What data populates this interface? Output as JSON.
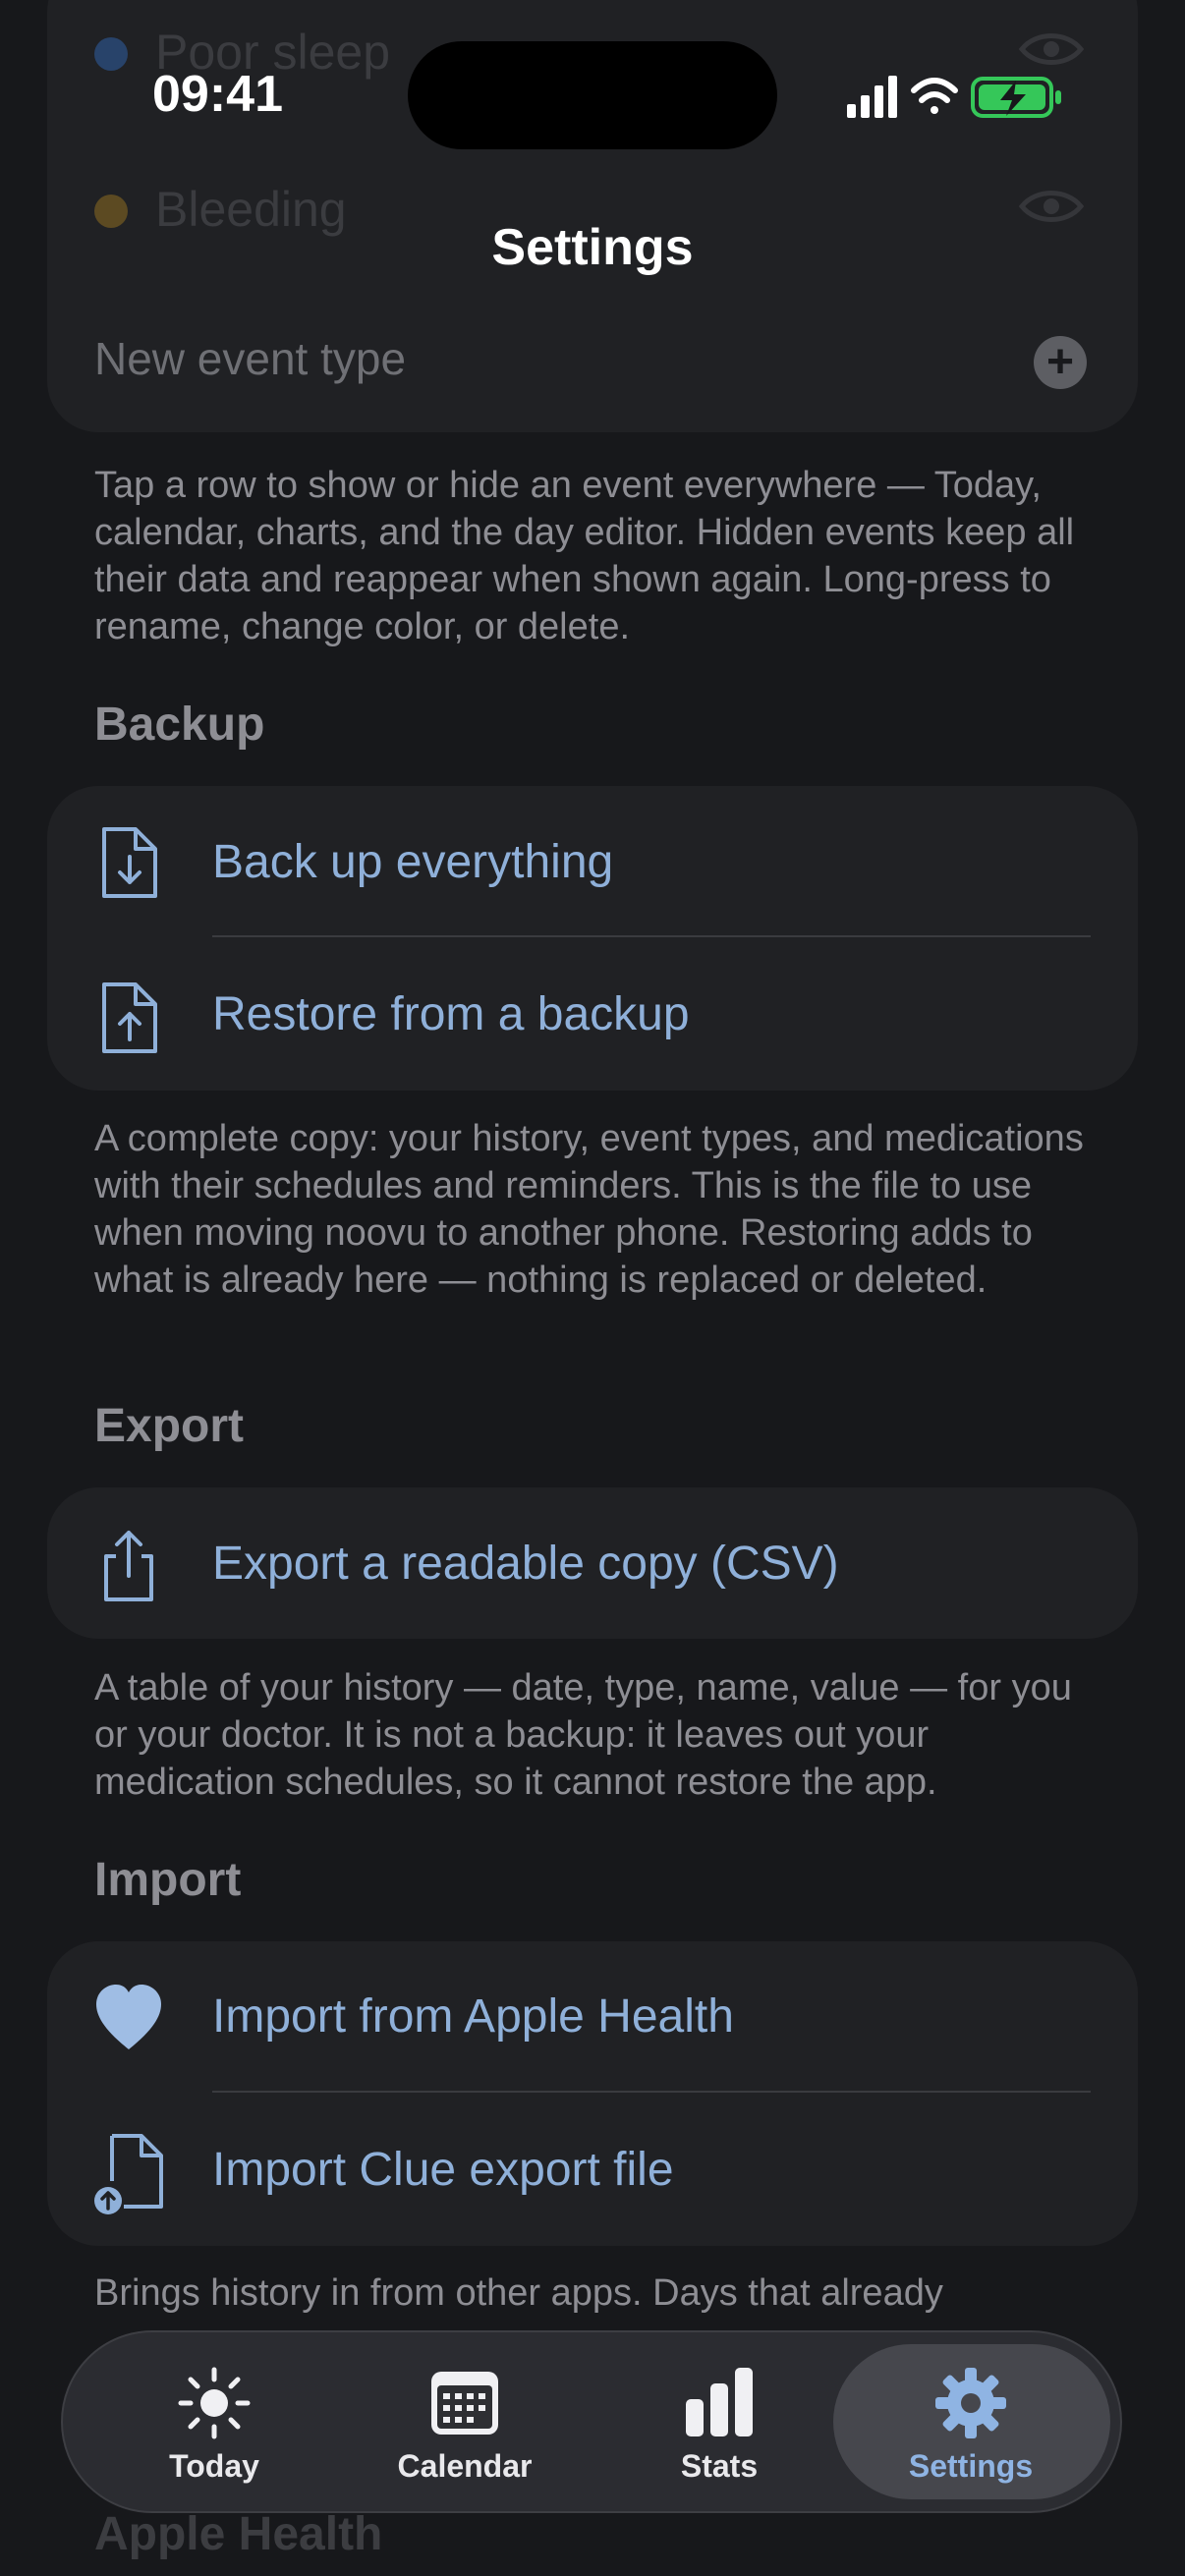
{
  "status_bar": {
    "time": "09:41"
  },
  "header": {
    "title": "Settings"
  },
  "events_list": {
    "ghost_rows": [
      {
        "label": "Poor sleep",
        "color": "#3c6fb5"
      },
      {
        "label": "Bleeding",
        "color": "#b5882c"
      }
    ],
    "new_event_placeholder": "New event type",
    "footnote": "Tap a row to show or hide an event everywhere — Today, calendar, charts, and the day editor. Hidden events keep all their data and reappear when shown again. Long-press to rename, change color, or delete."
  },
  "backup": {
    "title": "Backup",
    "rows": [
      {
        "label": "Back up everything",
        "icon": "document-download-icon"
      },
      {
        "label": "Restore from a backup",
        "icon": "document-upload-icon"
      }
    ],
    "footnote": "A complete copy: your history, event types, and medications with their schedules and reminders. This is the file to use when moving noovu to another phone. Restoring adds to what is already here — nothing is replaced or deleted."
  },
  "export": {
    "title": "Export",
    "rows": [
      {
        "label": "Export a readable copy (CSV)",
        "icon": "share-icon"
      }
    ],
    "footnote": "A table of your history — date, type, name, value — for you or your doctor. It is not a backup: it leaves out your medication schedules, so it cannot restore the app."
  },
  "import": {
    "title": "Import",
    "rows": [
      {
        "label": "Import from Apple Health",
        "icon": "heart-icon"
      },
      {
        "label": "Import Clue export file",
        "icon": "document-import-icon"
      }
    ],
    "footnote": "Brings history in from other apps. Days that already"
  },
  "apple_health": {
    "title": "Apple Health"
  },
  "tabbar": {
    "tabs": [
      {
        "label": "Today",
        "icon": "sun-icon"
      },
      {
        "label": "Calendar",
        "icon": "calendar-icon"
      },
      {
        "label": "Stats",
        "icon": "bar-chart-icon"
      },
      {
        "label": "Settings",
        "icon": "gear-icon"
      }
    ],
    "active": "Settings"
  },
  "colors": {
    "background": "#17181b",
    "card": "#202124",
    "accent": "#8fb0d9",
    "battery_green": "#35c759"
  }
}
